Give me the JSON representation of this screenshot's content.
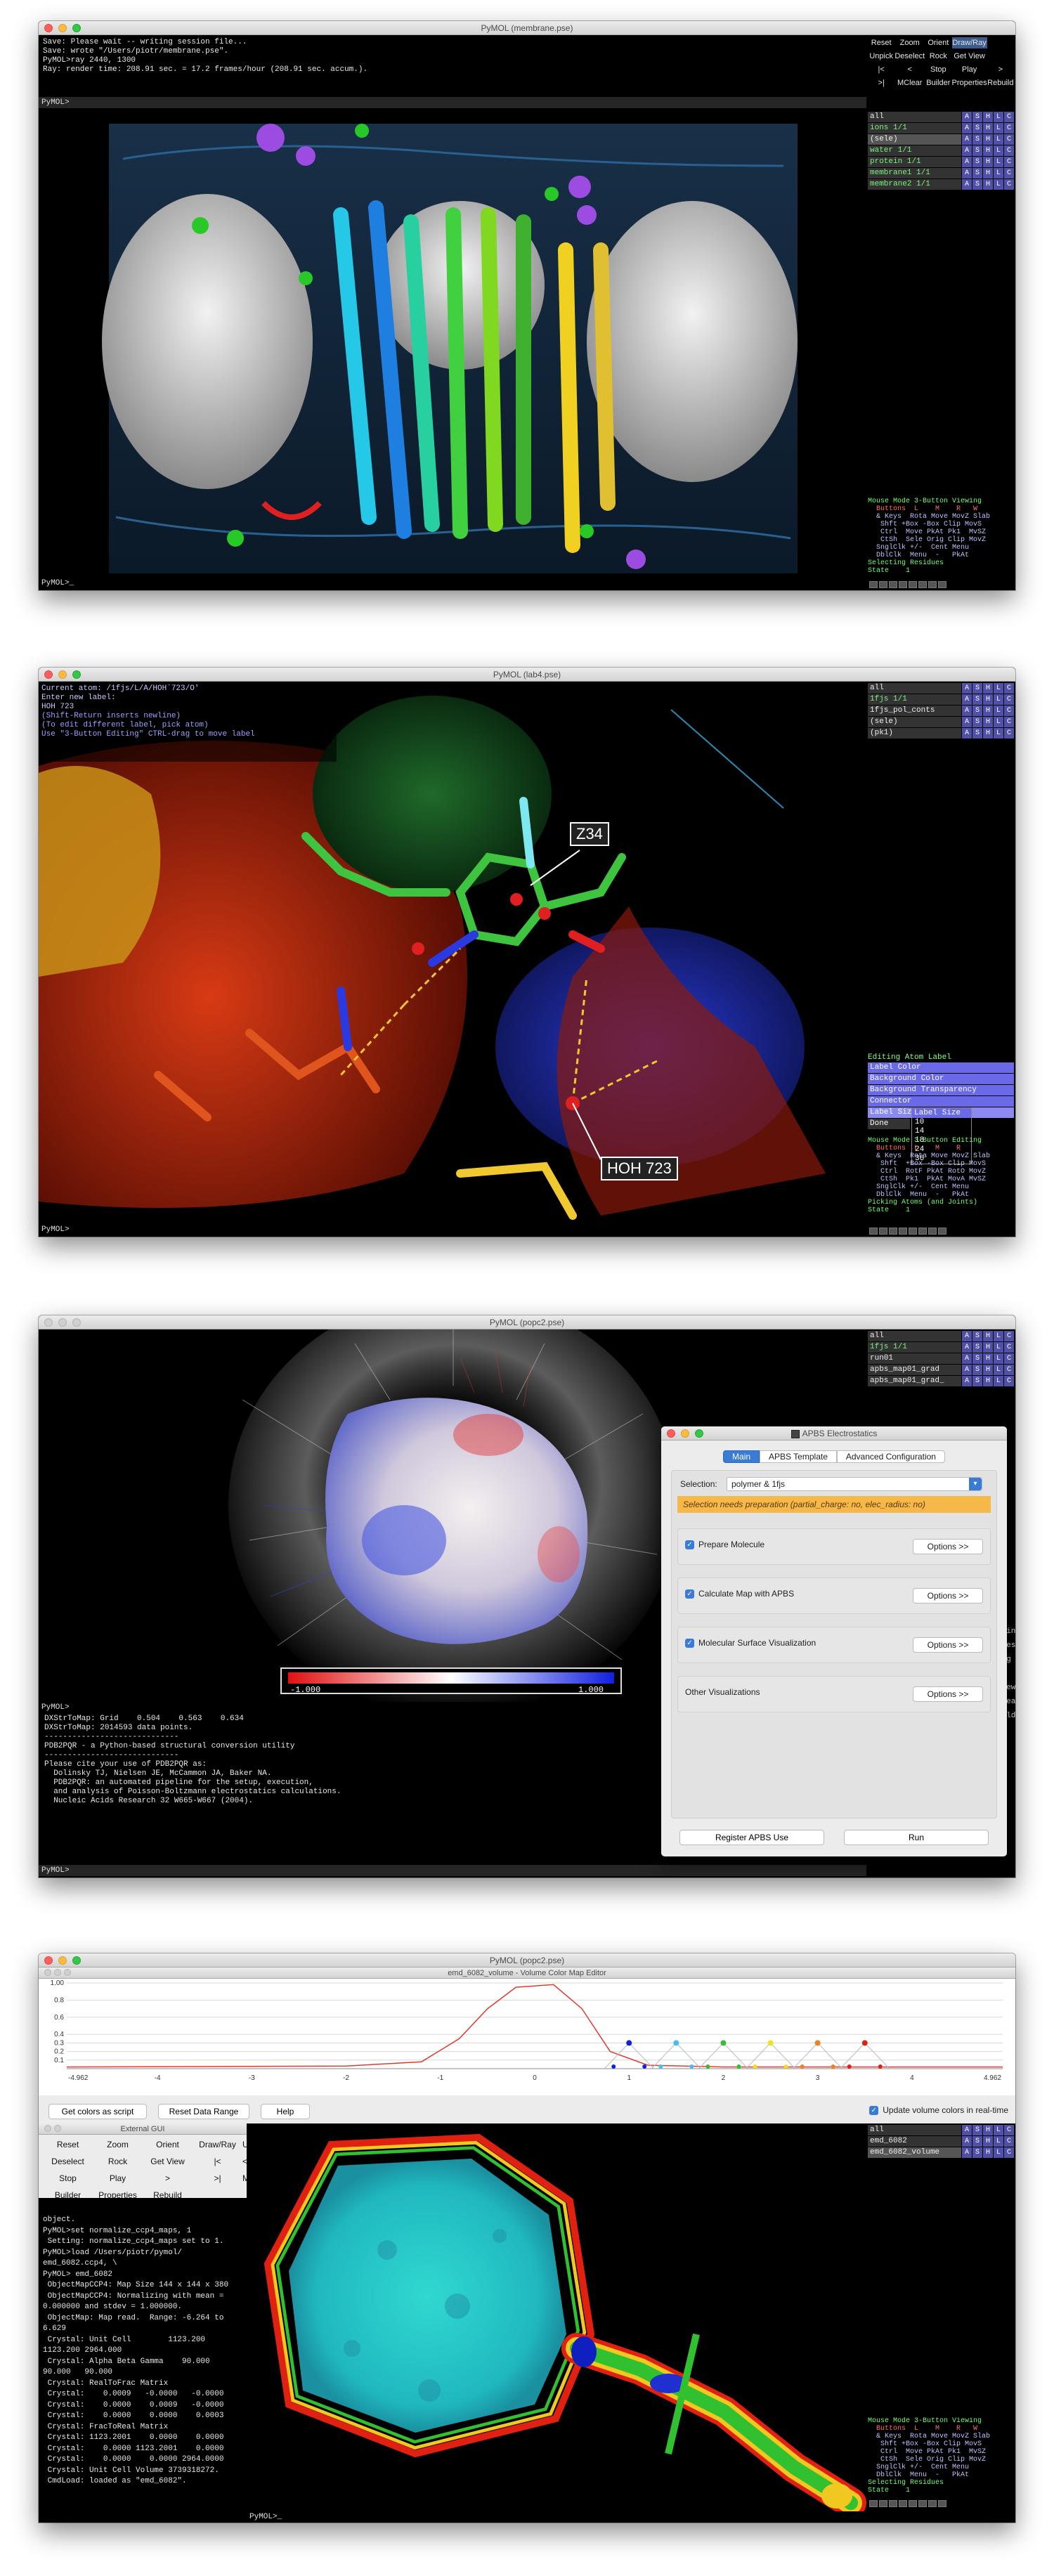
{
  "colors": {
    "accent": "#3a7bd5",
    "pymol_button": "#5050a8",
    "selected_mode": "#3b5b8e",
    "label_panel": "#6a6ae8"
  },
  "w1": {
    "title": "PyMOL (membrane.pse)",
    "console": [
      "Save: Please wait -- writing session file...",
      "Save: wrote \"/Users/piotr/membrane.pse\".",
      "PyMOL>ray 2440, 1300",
      "Ray: render time: 208.91 sec. = 17.2 frames/hour (208.91 sec. accum.)."
    ],
    "prompt": "PyMOL>",
    "prompt2": "PyMOL>_",
    "buttons": [
      "Reset",
      "Zoom",
      "Orient",
      "Draw/Ray",
      "",
      "Unpick",
      "Deselect",
      "Rock",
      "Get View",
      "",
      "|<",
      "<",
      "Stop",
      "Play",
      ">",
      ">|",
      "MClear",
      "Builder",
      "Properties",
      "Rebuild"
    ],
    "objects": [
      {
        "name": "all",
        "sel": false
      },
      {
        "name": "ions 1/1",
        "sel": false
      },
      {
        "name": "(sele)",
        "sel": true
      },
      {
        "name": "water 1/1",
        "sel": false
      },
      {
        "name": "protein 1/1",
        "sel": false
      },
      {
        "name": "membrane1 1/1",
        "sel": false
      },
      {
        "name": "membrane2 1/1",
        "sel": false
      }
    ],
    "abhs": [
      "A",
      "S",
      "H",
      "L",
      "C"
    ],
    "mouse": [
      "Mouse Mode 3-Button Viewing",
      "  Buttons  L    M    R   W",
      "  & Keys  Rota Move MovZ Slab",
      "   Shft +Box -Box Clip MovS",
      "   Ctrl  Move PkAt Pk1  MvSZ",
      "   CtSh  Sele Orig Clip MovZ",
      "  SnglClk +/-  Cent Menu",
      "  DblClk  Menu  -   PkAt",
      "Selecting Residues",
      "State    1"
    ]
  },
  "w2": {
    "title": "PyMOL (lab4.pse)",
    "console": [
      "Current atom: /1fjs/L/A/HOH`723/O'",
      "Enter new label:",
      "HOH 723",
      "",
      "(Shift-Return inserts newline)",
      "(To edit different label, pick atom)",
      "",
      "Use \"3-Button Editing\" CTRL-drag to move label"
    ],
    "prompt": "PyMOL>",
    "objects": [
      {
        "name": "all",
        "sel": false
      },
      {
        "name": "1fjs 1/1",
        "sel": false
      },
      {
        "name": "1fjs_pol_conts",
        "sel": false
      },
      {
        "name": "(sele)",
        "sel": false
      },
      {
        "name": "(pk1)",
        "sel": false
      }
    ],
    "labels": [
      "Z34",
      "HOH 723"
    ],
    "label_panel": {
      "title": "Editing Atom Label",
      "items": [
        "Label Color",
        "Background Color",
        "Background Transparency",
        "Connector",
        "Label Size"
      ],
      "done": "Done",
      "submenu_title": "Label Size",
      "sizes": [
        "10",
        "14",
        "18",
        "24",
        "36"
      ]
    },
    "mouse": [
      "Mouse Mode 3-Button Editing",
      "  Buttons  L    M    R",
      "  & Keys  Rota Move MovZ Slab",
      "   Shft  +Box -Box Clip MovS",
      "   Ctrl  RotF PkAt RotO MovZ",
      "   CtSh  Pk1  PkAt MovA MvSZ",
      "  SnglClk +/-  Cent Menu",
      "  DblClk  Menu  -   PkAt",
      "Picking Atoms (and Joints)",
      "State    1"
    ]
  },
  "w3": {
    "title": "PyMOL (popc2.pse)",
    "console": [
      "DXStrToMap: Grid    0.504    0.563    0.634",
      "DXStrToMap: 2014593 data points.",
      "",
      "-----------------------------",
      "PDB2PQR - a Python-based structural conversion utility",
      "-----------------------------",
      "Please cite your use of PDB2PQR as:",
      "  Dolinsky TJ, Nielsen JE, McCammon JA, Baker NA.",
      "  PDB2PQR: an automated pipeline for the setup, execution,",
      "  and analysis of Poisson-Boltzmann electrostatics calculations.",
      "  Nucleic Acids Research 32 W665-W667 (2004)."
    ],
    "prompt": "PyMOL>",
    "prompt2": "PyMOL>",
    "objects": [
      {
        "name": "all",
        "sel": false
      },
      {
        "name": "1fjs 1/1",
        "sel": false
      },
      {
        "name": "run01",
        "sel": false
      },
      {
        "name": "apbs_map01_grad",
        "sel": false
      },
      {
        "name": "apbs_map01_grad_",
        "sel": false
      }
    ],
    "scale_min": "-1.000",
    "scale_max": "1.000",
    "right_fragments": [
      "oving",
      "thes",
      "ing",
      "L",
      "View",
      "Clear",
      "uild"
    ],
    "apbs": {
      "title": "APBS Electrostatics",
      "tabs": [
        "Main",
        "APBS Template",
        "Advanced Configuration"
      ],
      "selection_label": "Selection:",
      "selection_value": "polymer & 1fjs",
      "warning": "Selection needs preparation (partial_charge: no, elec_radius: no)",
      "sections": [
        {
          "label": "Prepare Molecule",
          "checked": true,
          "btn": "Options >>"
        },
        {
          "label": "Calculate Map with APBS",
          "checked": true,
          "btn": "Options >>"
        },
        {
          "label": "Molecular Surface Visualization",
          "checked": true,
          "btn": "Options >>"
        },
        {
          "label": "Other Visualizations",
          "checked": false,
          "btn": "Options >>"
        }
      ],
      "register": "Register APBS Use",
      "run": "Run"
    }
  },
  "w4": {
    "title": "PyMOL (popc2.pse)",
    "editor_title": "emd_6082_volume - Volume Color Map Editor",
    "y_ticks": [
      "1.00",
      "0.8",
      "0.6",
      "0.4",
      "0.3",
      "0.2",
      "0.1"
    ],
    "x_ticks": [
      "-4",
      "-3",
      "-2",
      "-1",
      "0",
      "1",
      "2",
      "3",
      "4"
    ],
    "x_min": "-4.962",
    "x_max": "4.962",
    "get_colors": "Get colors as script",
    "reset_range": "Reset Data Range",
    "help": "Help",
    "update_rt": "Update volume colors in real-time",
    "ext_gui_title": "External GUI",
    "ext_buttons": [
      "Reset",
      "Zoom",
      "Orient",
      "Draw/Ray",
      "Unpick",
      "Deselect",
      "Rock",
      "Get View",
      "|<",
      "<",
      "Stop",
      "Play",
      ">",
      ">|",
      "MClear",
      "Builder",
      "Properties",
      "Rebuild"
    ],
    "console": [
      "object.",
      "PyMOL>set normalize_ccp4_maps, 1",
      " Setting: normalize_ccp4_maps set to 1.",
      "PyMOL>load /Users/piotr/pymol/",
      "emd_6082.ccp4, \\",
      "PyMOL> emd_6082",
      " ObjectMapCCP4: Map Size 144 x 144 x 380",
      " ObjectMapCCP4: Normalizing with mean =",
      "0.000000 and stdev = 1.000000.",
      " ObjectMap: Map read.  Range: -6.264 to",
      "6.629",
      " Crystal: Unit Cell        1123.200",
      "1123.200 2964.000",
      " Crystal: Alpha Beta Gamma    90.000",
      "90.000   90.000",
      " Crystal: RealToFrac Matrix",
      " Crystal:    0.0009   -0.0000   -0.0000",
      " Crystal:    0.0000    0.0009   -0.0000",
      " Crystal:    0.0000    0.0000    0.0003",
      " Crystal: FracToReal Matrix",
      " Crystal: 1123.2001    0.0000    0.0000",
      " Crystal:    0.0000 1123.2001    0.0000",
      " Crystal:    0.0000    0.0000 2964.0000",
      " Crystal: Unit Cell Volume 3739318272.",
      " CmdLoad: loaded as \"emd_6082\"."
    ],
    "prompt": "PyMOL>_",
    "objects": [
      {
        "name": "all",
        "sel": false
      },
      {
        "name": "emd_6082",
        "sel": false
      },
      {
        "name": "emd_6082_volume",
        "sel": true
      }
    ],
    "mouse": [
      "Mouse Mode 3-Button Viewing",
      "  Buttons  L    M    R   W",
      "  & Keys  Rota Move MovZ Slab",
      "   Shft +Box -Box Clip MovS",
      "   Ctrl  Move PkAt Pk1  MvSZ",
      "   CtSh  Sele Orig Clip MovZ",
      "  SnglClk +/-  Cent Menu",
      "  DblClk  Menu  -   PkAt",
      "Selecting Residues",
      "State    1"
    ],
    "chart_data": {
      "type": "line",
      "x": [
        -4.962,
        -2,
        -1.2,
        -0.8,
        -0.5,
        -0.2,
        0.2,
        0.5,
        0.8,
        1.2,
        2,
        4.962
      ],
      "y": [
        0.02,
        0.03,
        0.08,
        0.35,
        0.7,
        0.95,
        0.98,
        0.7,
        0.2,
        0.04,
        0.02,
        0.02
      ],
      "xlim": [
        -4.962,
        4.962
      ],
      "ylim": [
        0,
        1
      ]
    }
  }
}
